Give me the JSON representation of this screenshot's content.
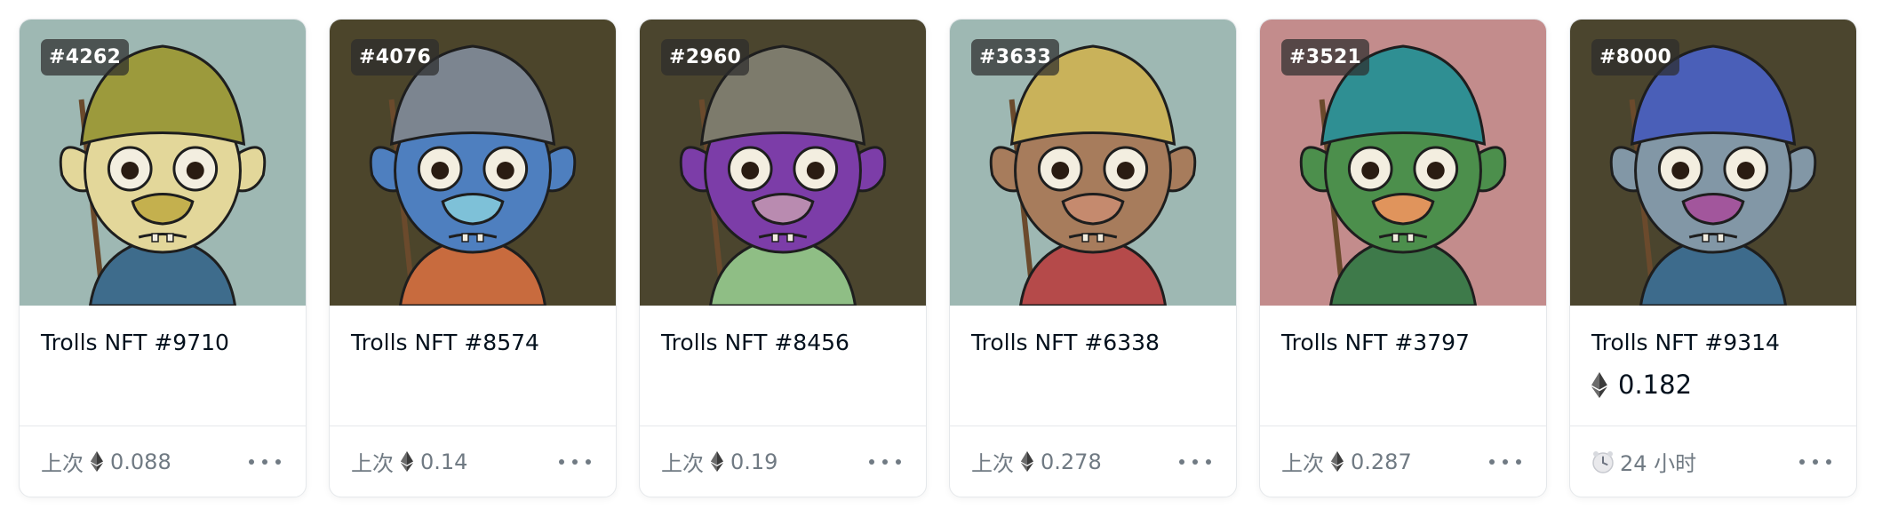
{
  "cards": [
    {
      "tag": "#4262",
      "name": "Trolls NFT #9710",
      "price": "",
      "footer_label": "上次",
      "footer_value": "0.088",
      "footer_icon": "eth-icon",
      "colors": {
        "bg": "#9eb8b3",
        "hat": "#9c9a3c",
        "skin": "#e3d79a",
        "beak": "#c4b04e",
        "cloak": "#3e6c8c"
      },
      "more_icon": "more-dots-icon"
    },
    {
      "tag": "#4076",
      "name": "Trolls NFT #8574",
      "price": "",
      "footer_label": "上次",
      "footer_value": "0.14",
      "footer_icon": "eth-icon",
      "colors": {
        "bg": "#4c452b",
        "hat": "#7c8590",
        "skin": "#4e7fbf",
        "beak": "#7ec1d8",
        "cloak": "#c86b3e"
      },
      "more_icon": "more-dots-icon"
    },
    {
      "tag": "#2960",
      "name": "Trolls NFT #8456",
      "price": "",
      "footer_label": "上次",
      "footer_value": "0.19",
      "footer_icon": "eth-icon",
      "colors": {
        "bg": "#4b452e",
        "hat": "#7d7b6c",
        "skin": "#7c3da8",
        "beak": "#b98bb0",
        "cloak": "#8fbe85"
      },
      "more_icon": "more-dots-icon"
    },
    {
      "tag": "#3633",
      "name": "Trolls NFT #6338",
      "price": "",
      "footer_label": "上次",
      "footer_value": "0.278",
      "footer_icon": "eth-icon",
      "colors": {
        "bg": "#9eb8b3",
        "hat": "#c9b25a",
        "skin": "#a77c5c",
        "beak": "#c58a6e",
        "cloak": "#b54a4a"
      },
      "more_icon": "more-dots-icon"
    },
    {
      "tag": "#3521",
      "name": "Trolls NFT #3797",
      "price": "",
      "footer_label": "上次",
      "footer_value": "0.287",
      "footer_icon": "eth-icon",
      "colors": {
        "bg": "#c38c8c",
        "hat": "#2f8f93",
        "skin": "#4c8f4c",
        "beak": "#e0945c",
        "cloak": "#3e7a4a"
      },
      "more_icon": "more-dots-icon"
    },
    {
      "tag": "#8000",
      "name": "Trolls NFT #9314",
      "price": "0.182",
      "footer_label": "",
      "footer_value": "24 小时",
      "footer_icon": "clock-icon",
      "colors": {
        "bg": "#4b452e",
        "hat": "#4a5fb8",
        "skin": "#8297a6",
        "beak": "#a2569c",
        "cloak": "#3d6b8c"
      },
      "more_icon": "more-dots-icon"
    }
  ]
}
